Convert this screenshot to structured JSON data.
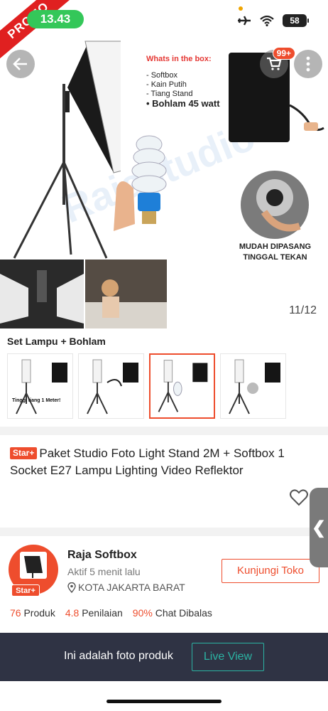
{
  "status_bar": {
    "time": "13.43",
    "battery": "58"
  },
  "gallery": {
    "promo_label": "PROMO",
    "cart_badge": "99+",
    "box_title": "Whats in the box:",
    "box_items": [
      "- Softbox",
      "- Kain Putih",
      "- Tiang Stand"
    ],
    "box_item_bold": "• Bohlam 45 watt",
    "watermark": "Rajastudio",
    "install_text": "MUDAH DIPASANG TINGGAL TEKAN",
    "page_counter": "11/12"
  },
  "variant": {
    "title": "Set Lampu + Bohlam",
    "thumbs": [
      {
        "caption": "Tinggi tiang 1 Meter!"
      },
      {
        "caption": ""
      },
      {
        "caption": ""
      },
      {
        "caption": ""
      }
    ],
    "active_index": 2
  },
  "product": {
    "badge": "Star+",
    "title": "Paket Studio Foto Light Stand 2M + Softbox 1 Socket E27 Lampu Lighting Video Reflektor"
  },
  "side_tab": {
    "label": "❮"
  },
  "shop": {
    "name": "Raja Softbox",
    "active": "Aktif 5 menit lalu",
    "location": "KOTA JAKARTA BARAT",
    "badge": "Star+",
    "visit_label": "Kunjungi Toko",
    "stats": [
      {
        "num": "76",
        "label": "Produk"
      },
      {
        "num": "4.8",
        "label": "Penilaian"
      },
      {
        "num": "90%",
        "label": "Chat Dibalas"
      }
    ]
  },
  "bottom_bar": {
    "text": "Ini adalah foto produk",
    "button": "Live View"
  },
  "colors": {
    "accent": "#ee4d2d",
    "teal": "#2bb3a3",
    "bar": "#2f3344",
    "time_pill": "#34c759"
  }
}
